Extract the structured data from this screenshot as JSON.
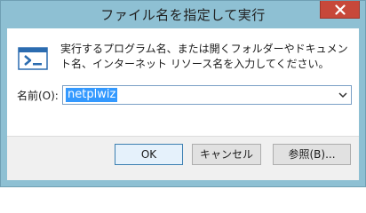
{
  "window": {
    "title": "ファイル名を指定して実行"
  },
  "dialog": {
    "description": "実行するプログラム名、または開くフォルダーやドキュメント名、インターネット リソース名を入力してください。",
    "open_label": "名前(O):",
    "input_value": "netplwiz"
  },
  "buttons": {
    "ok": "OK",
    "cancel": "キャンセル",
    "browse": "参照(B)..."
  },
  "colors": {
    "frame": "#8ec0d3",
    "close_button": "#c7483a",
    "selection": "#3399ff"
  },
  "icons": {
    "app": "run-dialog-icon",
    "close": "close-icon",
    "dropdown": "chevron-down-icon"
  }
}
